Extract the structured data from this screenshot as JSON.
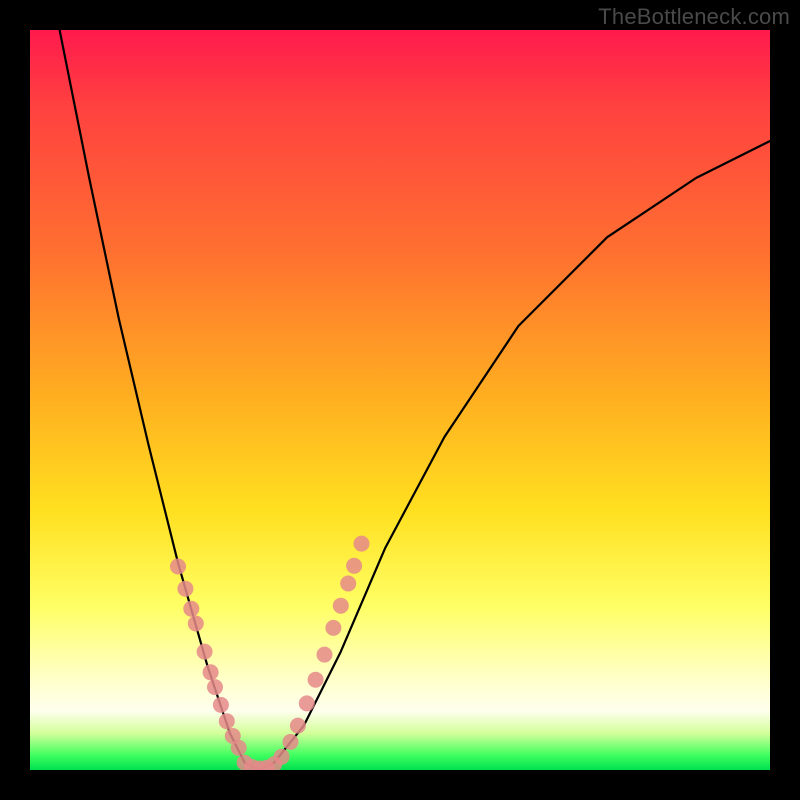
{
  "watermark": "TheBottleneck.com",
  "chart_data": {
    "type": "line",
    "title": "",
    "xlabel": "",
    "ylabel": "",
    "xlim": [
      0,
      1
    ],
    "ylim": [
      0,
      1
    ],
    "background_gradient": [
      "#ff1a4d",
      "#ff7030",
      "#ffe020",
      "#ffffcc",
      "#00e050"
    ],
    "series": [
      {
        "name": "bottleneck-curve",
        "color": "#000000",
        "x": [
          0.04,
          0.08,
          0.12,
          0.16,
          0.2,
          0.24,
          0.27,
          0.29,
          0.31,
          0.33,
          0.37,
          0.42,
          0.48,
          0.56,
          0.66,
          0.78,
          0.9,
          1.0
        ],
        "y": [
          1.0,
          0.8,
          0.61,
          0.44,
          0.28,
          0.14,
          0.05,
          0.01,
          0.0,
          0.01,
          0.06,
          0.16,
          0.3,
          0.45,
          0.6,
          0.72,
          0.8,
          0.85
        ]
      },
      {
        "name": "highlight-dots-left",
        "type": "scatter",
        "color": "#e58a8a",
        "x": [
          0.2,
          0.21,
          0.218,
          0.224,
          0.236,
          0.244,
          0.25,
          0.258,
          0.266,
          0.274,
          0.282
        ],
        "y": [
          0.275,
          0.245,
          0.218,
          0.198,
          0.16,
          0.132,
          0.112,
          0.088,
          0.066,
          0.046,
          0.03
        ]
      },
      {
        "name": "highlight-dots-bottom",
        "type": "scatter",
        "color": "#e58a8a",
        "x": [
          0.29,
          0.3,
          0.31,
          0.32,
          0.33,
          0.34
        ],
        "y": [
          0.01,
          0.004,
          0.002,
          0.003,
          0.008,
          0.018
        ]
      },
      {
        "name": "highlight-dots-right",
        "type": "scatter",
        "color": "#e58a8a",
        "x": [
          0.352,
          0.362,
          0.374,
          0.386,
          0.398,
          0.41,
          0.42,
          0.43,
          0.438,
          0.448
        ],
        "y": [
          0.038,
          0.06,
          0.09,
          0.122,
          0.156,
          0.192,
          0.222,
          0.252,
          0.276,
          0.306
        ]
      }
    ]
  }
}
